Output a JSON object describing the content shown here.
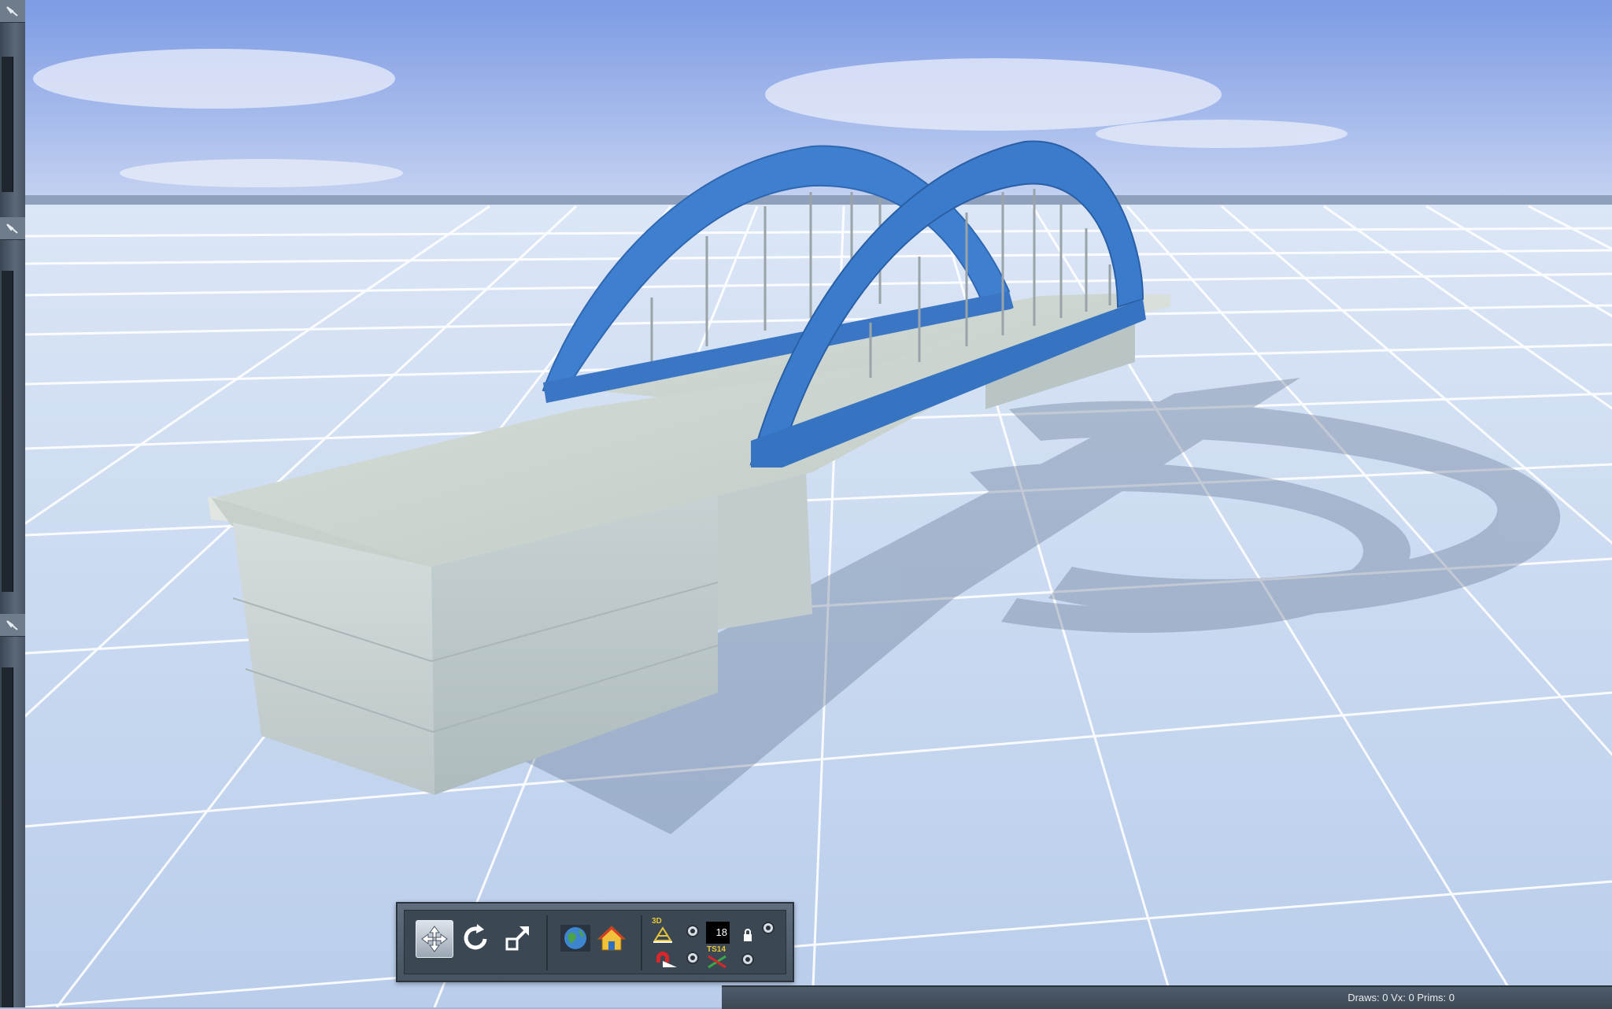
{
  "toolbar": {
    "number_box_value": "18",
    "label_3d": "3D",
    "label_ts": "TS14",
    "buttons": [
      {
        "name": "move-tool",
        "icon": "move-arrows-icon",
        "active": true
      },
      {
        "name": "rotate-tool",
        "icon": "rotate-icon",
        "active": false
      },
      {
        "name": "scale-tool",
        "icon": "scale-icon",
        "active": false
      },
      {
        "name": "world-view",
        "icon": "globe-icon",
        "active": false
      },
      {
        "name": "home-view",
        "icon": "home-icon",
        "active": false
      }
    ]
  },
  "status": {
    "text": "Draws: 0 Vx: 0 Prims: 0"
  },
  "colors": {
    "sky_top": "#7f9fe6",
    "sky_horizon": "#b9c9ef",
    "ground": "#c9daf2",
    "grid_line": "#ffffff",
    "arch_blue": "#3a78c9",
    "concrete": "#c9d2cf",
    "toolbar_bg": "#4f5c6b"
  }
}
